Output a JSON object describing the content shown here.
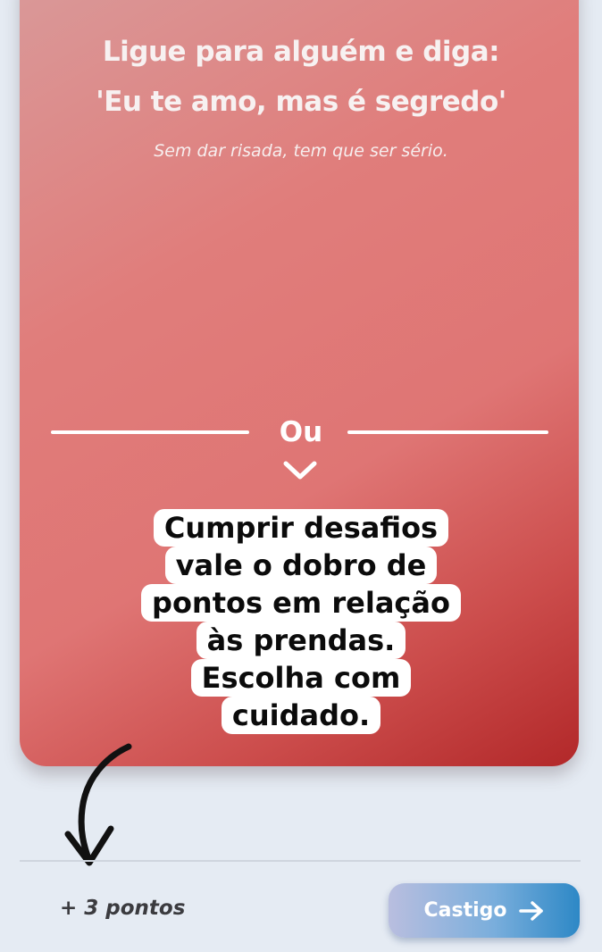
{
  "challenge": {
    "title_line1": "Ligue para alguém e diga:",
    "title_line2": "'Eu te amo, mas é segredo'",
    "hint": "Sem dar risada, tem que ser sério."
  },
  "divider": {
    "label": "Ou"
  },
  "tooltip": {
    "lines": [
      "Cumprir desafios",
      "vale o dobro de",
      "pontos em relação",
      "às prendas.",
      "Escolha com",
      "cuidado."
    ]
  },
  "footer": {
    "points": "+ 3 pontos",
    "button_label": "Castigo"
  },
  "icons": {
    "chevron": "chevron-down-icon",
    "button_arrow": "arrow-right-icon",
    "annotation_arrow": "hand-drawn-arrow-icon"
  },
  "colors": {
    "card_top": "#d99a9a",
    "card_bottom": "#b22829",
    "button_start": "#b9bedf",
    "button_end": "#2d88c6",
    "background": "#e5ebf3"
  }
}
